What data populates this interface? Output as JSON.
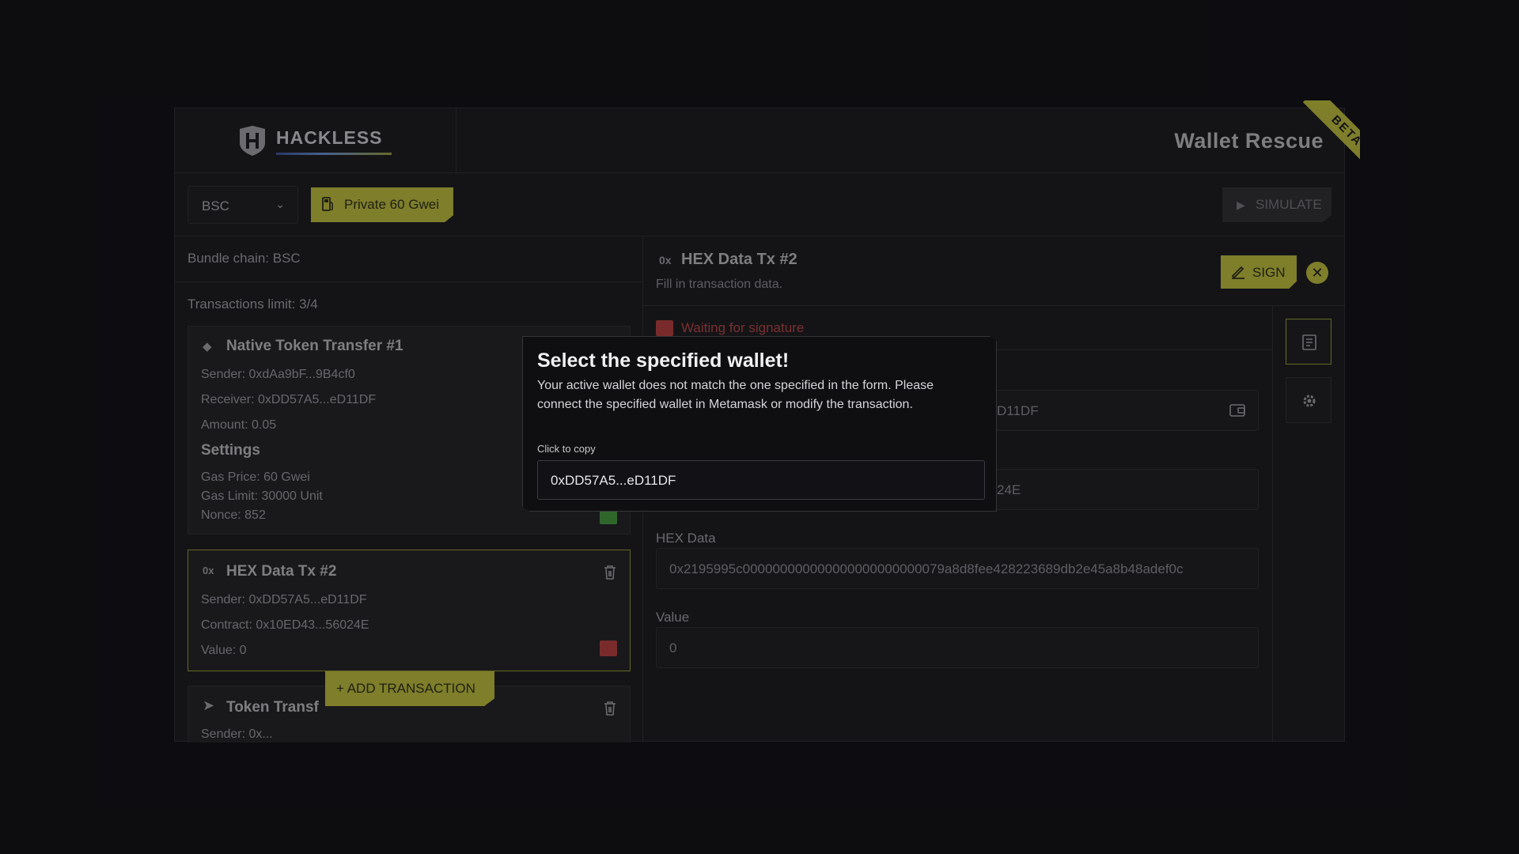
{
  "header": {
    "logo_text": "HACKLESS",
    "app_title": "Wallet Rescue",
    "beta_label": "BETA"
  },
  "toolbar": {
    "chain_select": "BSC",
    "gas_button": "Private 60 Gwei",
    "simulate_button": "SIMULATE"
  },
  "left": {
    "bundle_chain": "Bundle chain: BSC",
    "tx_limit": "Transactions limit:  3/4",
    "cards": [
      {
        "icon": "◆",
        "title": "Native Token Transfer #1",
        "sender": "Sender: 0xdAa9bF...9B4cf0",
        "receiver": "Receiver: 0xDD57A5...eD11DF",
        "amount": "Amount: 0.05",
        "settings_heading": "Settings",
        "gas_price": "Gas Price: 60 Gwei",
        "gas_limit": "Gas Limit: 30000 Unit",
        "nonce": "Nonce: 852"
      },
      {
        "icon": "0x",
        "title": "HEX Data Tx #2",
        "sender": "Sender: 0xDD57A5...eD11DF",
        "contract": "Contract: 0x10ED43...56024E",
        "value": "Value: 0"
      },
      {
        "icon": "➤",
        "title": "Token Transf",
        "sender": "Sender: 0x..."
      }
    ],
    "add_button": "+ ADD TRANSACTION"
  },
  "right": {
    "icon": "0x",
    "title": "HEX Data Tx #2",
    "subtitle": "Fill in transaction data.",
    "sign_button": "SIGN",
    "close_button": "✕",
    "status": "Waiting for signature",
    "field_sender_partial": "D11DF",
    "field_contract_partial": "24E",
    "hex_label": "HEX Data",
    "hex_value": "0x2195995c000000000000000000000000079a8d8fee428223689db2e45a8b48adef0c",
    "value_label": "Value",
    "value_value": "0"
  },
  "modal": {
    "title": "Select the specified wallet!",
    "message": "Your active wallet does not match the one specified in the form. Please connect the specified wallet in Metamask or modify the transaction.",
    "copy_label": "Click to copy",
    "copy_value": "0xDD57A5...eD11DF"
  },
  "colors": {
    "accent": "#a9a93a",
    "danger": "#a23a3a",
    "success": "#3f8a3a",
    "background": "#1b1b1f"
  }
}
